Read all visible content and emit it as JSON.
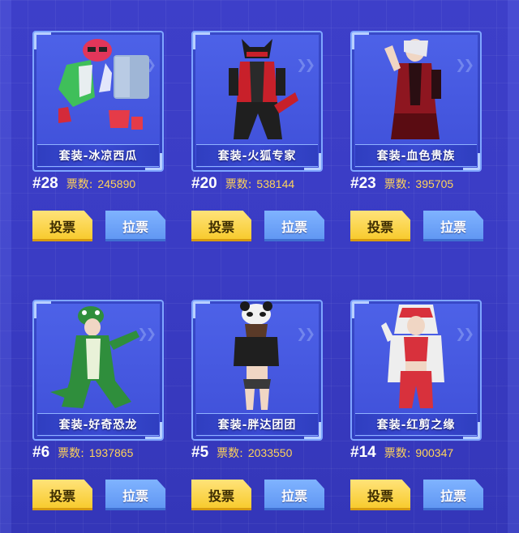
{
  "cards": [
    {
      "name": "套装-冰凉西瓜",
      "rank": "#28",
      "votes_label": "票数:",
      "votes": "245890",
      "vote_label": "投票",
      "canvass_label": "拉票",
      "accent": "#e2365a"
    },
    {
      "name": "套装-火狐专家",
      "rank": "#20",
      "votes_label": "票数:",
      "votes": "538144",
      "vote_label": "投票",
      "canvass_label": "拉票",
      "accent": "#c8202a"
    },
    {
      "name": "套装-血色贵族",
      "rank": "#23",
      "votes_label": "票数:",
      "votes": "395705",
      "vote_label": "投票",
      "canvass_label": "拉票",
      "accent": "#8e1620"
    },
    {
      "name": "套装-好奇恐龙",
      "rank": "#6",
      "votes_label": "票数:",
      "votes": "1937865",
      "vote_label": "投票",
      "canvass_label": "拉票",
      "accent": "#2f8e3c"
    },
    {
      "name": "套装-胖达团团",
      "rank": "#5",
      "votes_label": "票数:",
      "votes": "2033550",
      "vote_label": "投票",
      "canvass_label": "拉票",
      "accent": "#222222"
    },
    {
      "name": "套装-红剪之缘",
      "rank": "#14",
      "votes_label": "票数:",
      "votes": "900347",
      "vote_label": "投票",
      "canvass_label": "拉票",
      "accent": "#d8313c"
    }
  ]
}
